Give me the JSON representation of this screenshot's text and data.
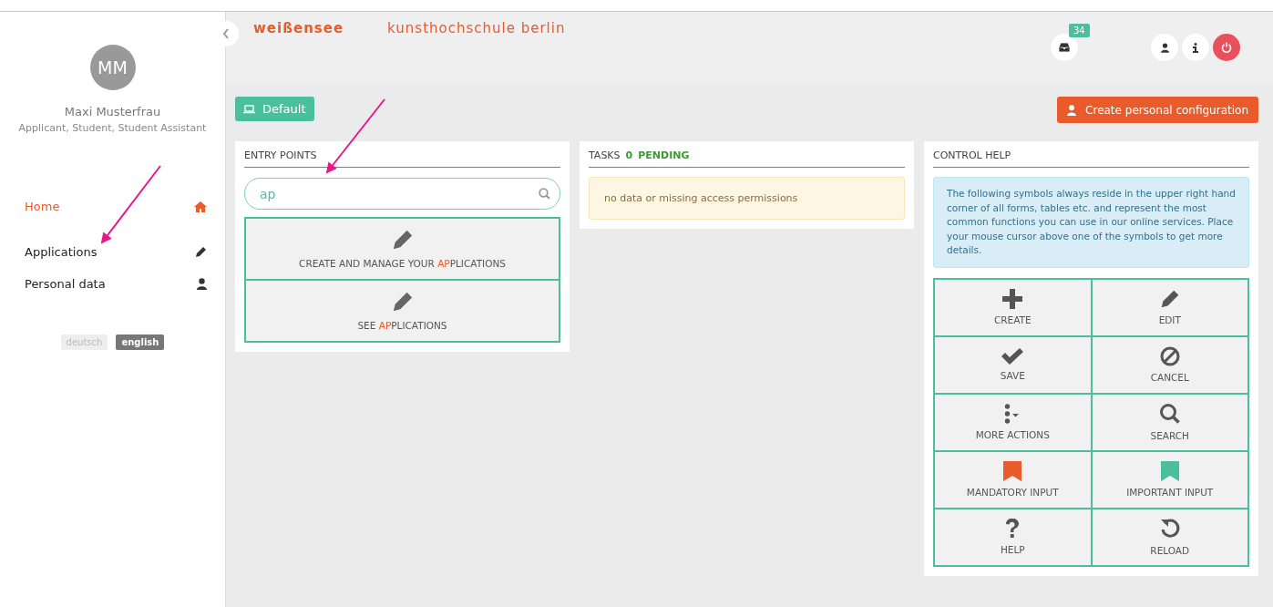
{
  "user": {
    "initials": "MM",
    "name": "Maxi Musterfrau",
    "roles": "Applicant, Student, Student Assistant"
  },
  "nav": [
    {
      "label": "Home",
      "selected": true
    },
    {
      "label": "Applications",
      "selected": false
    },
    {
      "label": "Personal data",
      "selected": false
    }
  ],
  "languages": [
    {
      "label": "deutsch",
      "selected": false
    },
    {
      "label": "english",
      "selected": true
    }
  ],
  "logo": {
    "left": "weißensee",
    "right": "kunsthochschule berlin"
  },
  "inbox_badge": "34",
  "config_button": "Default",
  "create_config_button": "Create personal configuration",
  "entry_points": {
    "title": "ENTRY POINTS",
    "search_value": "ap",
    "results": [
      {
        "before": "CREATE AND MANAGE YOUR ",
        "match": "AP",
        "after": "PLICATIONS"
      },
      {
        "before": "SEE ",
        "match": "AP",
        "after": "PLICATIONS"
      }
    ]
  },
  "tasks": {
    "title": "TASKS",
    "count": "0",
    "status": "PENDING",
    "message": "no data or missing access permissions"
  },
  "control_help": {
    "title": "CONTROL HELP",
    "info": "The following symbols always reside in the upper right hand corner of all forms, tables etc. and represent the most common functions you can use in our online services. Place your mouse cursor above one of the symbols to get more details.",
    "symbols": [
      {
        "label": "CREATE"
      },
      {
        "label": "EDIT"
      },
      {
        "label": "SAVE"
      },
      {
        "label": "CANCEL"
      },
      {
        "label": "MORE ACTIONS"
      },
      {
        "label": "SEARCH"
      },
      {
        "label": "MANDATORY INPUT",
        "color": "#e95b2b"
      },
      {
        "label": "IMPORTANT INPUT",
        "color": "#4bbf9c"
      },
      {
        "label": "HELP"
      },
      {
        "label": "RELOAD"
      }
    ]
  }
}
